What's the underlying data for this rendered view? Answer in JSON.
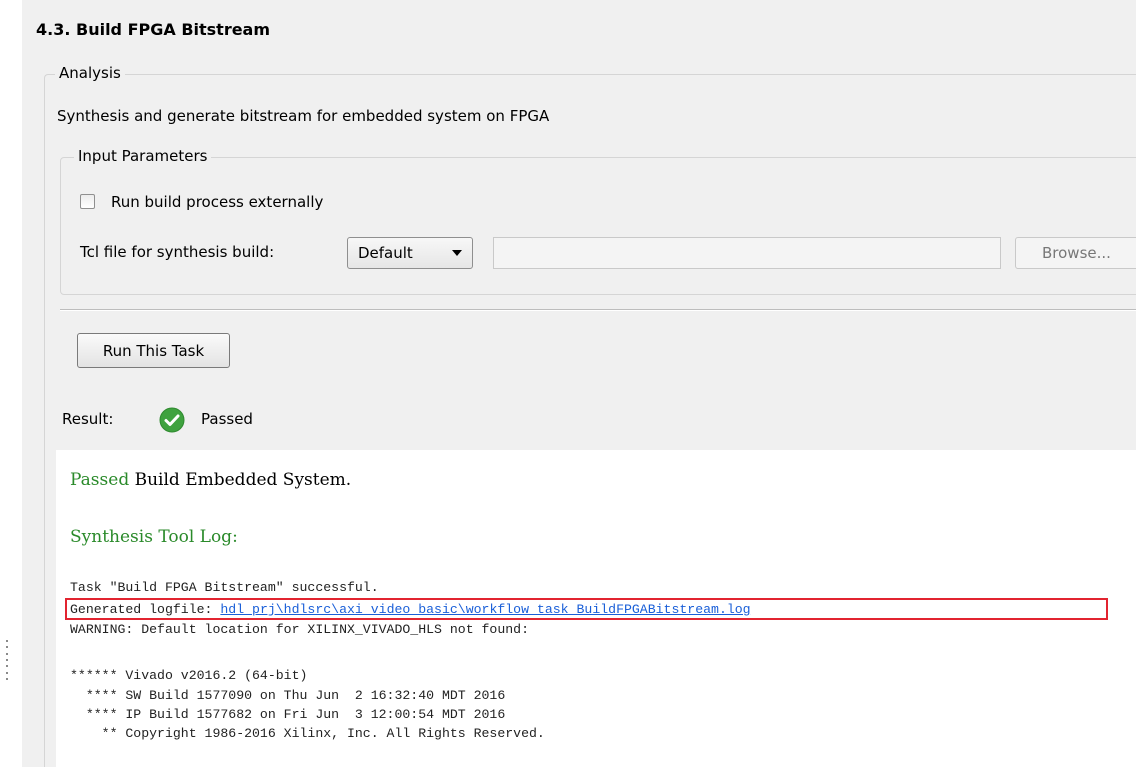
{
  "task": {
    "title": "4.3. Build FPGA Bitstream"
  },
  "analysis": {
    "legend": "Analysis",
    "description": "Synthesis and generate bitstream for embedded system on FPGA"
  },
  "input_parameters": {
    "legend": "Input Parameters",
    "run_externally_label": "Run build process externally",
    "run_externally_checked": false,
    "tcl_label": "Tcl file for synthesis build:",
    "tcl_dropdown_value": "Default",
    "tcl_path_value": "",
    "browse_label": "Browse..."
  },
  "actions": {
    "run_label": "Run This Task"
  },
  "result": {
    "label": "Result:",
    "value": "Passed",
    "icon": "check-circle-icon",
    "icon_color": "#3fa23f"
  },
  "log": {
    "status_word": "Passed",
    "status_rest": " Build Embedded System.",
    "heading": "Synthesis Tool Log:",
    "line1": "Task \"Build FPGA Bitstream\" successful.",
    "line2_prefix": "Generated logfile: ",
    "line2_link": "hdl_prj\\hdlsrc\\axi_video_basic\\workflow_task_BuildFPGABitstream.log",
    "line3": "WARNING: Default location for XILINX_VIVADO_HLS not found:",
    "line4": "****** Vivado v2016.2 (64-bit)",
    "line5": "  **** SW Build 1577090 on Thu Jun  2 16:32:40 MDT 2016",
    "line6": "  **** IP Build 1577682 on Fri Jun  3 12:00:54 MDT 2016",
    "line7": "    ** Copyright 1986-2016 Xilinx, Inc. All Rights Reserved.",
    "line8": ""
  },
  "colors": {
    "green_text": "#2a8a2a",
    "link": "#1a5fd8",
    "highlight_border": "#e22430"
  }
}
